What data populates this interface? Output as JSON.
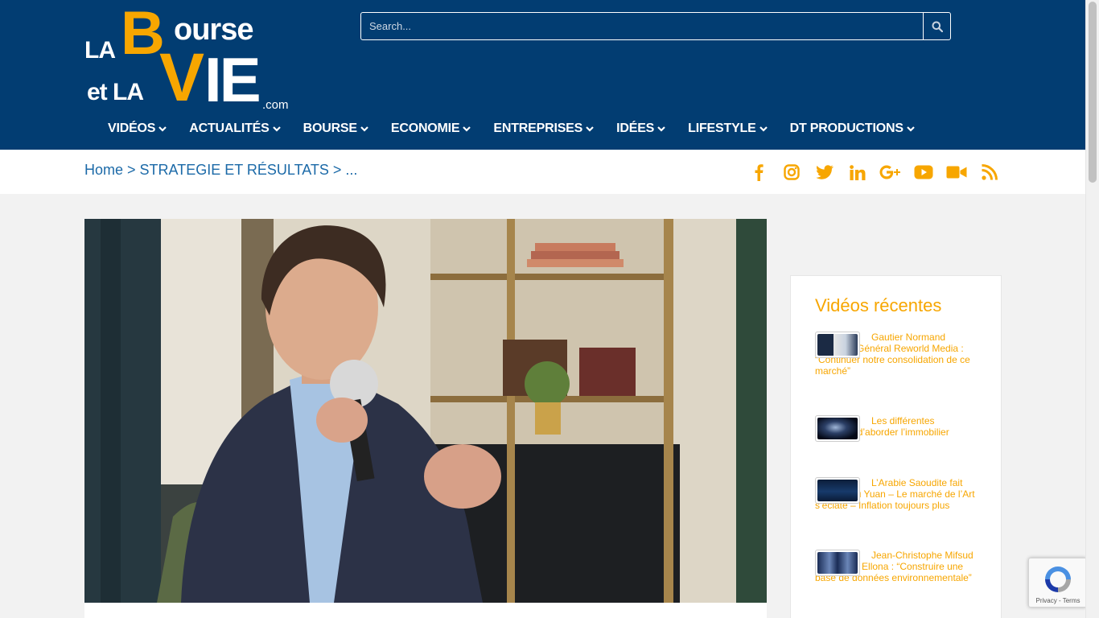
{
  "logo": {
    "la": "LA",
    "b": "B",
    "ourse": "ourse",
    "et_la": "et LA",
    "v": "V",
    "ie": "IE",
    "com": ".com"
  },
  "search": {
    "placeholder": "Search..."
  },
  "nav": [
    {
      "label": "VIDÉOS"
    },
    {
      "label": "ACTUALITÉS"
    },
    {
      "label": "BOURSE"
    },
    {
      "label": "ECONOMIE"
    },
    {
      "label": "ENTREPRISES"
    },
    {
      "label": "IDÉES"
    },
    {
      "label": "LIFESTYLE"
    },
    {
      "label": "DT PRODUCTIONS"
    }
  ],
  "breadcrumb": {
    "home": "Home",
    "sep1": " > ",
    "category": "STRATEGIE ET RÉSULTATS",
    "sep2": " > ",
    "current": "..."
  },
  "social_icons": [
    "facebook-icon",
    "instagram-icon",
    "twitter-icon",
    "linkedin-icon",
    "google-plus-icon",
    "youtube-icon",
    "video-camera-icon",
    "rss-icon"
  ],
  "sidebar": {
    "title": "Vidéos récentes",
    "videos": [
      {
        "title": "Gautier Normand Directeur Général Reworld Media : “Continuer notre consolidation de ce marché”"
      },
      {
        "title": "Les différentes manières d’aborder l’immobilier"
      },
      {
        "title": "L’Arabie Saoudite fait de l’oeil au Yuan – Le marché de l’Art s’éclate – Inflation toujours plus"
      },
      {
        "title": "Jean-Christophe Mifsud Fondateur Ellona : “Construire une base de données environnementale”"
      }
    ]
  },
  "recaptcha": {
    "text": "Privacy - Terms"
  },
  "colors": {
    "header": "#023d72",
    "accent": "#f7a600",
    "link": "#1c6aa8"
  }
}
